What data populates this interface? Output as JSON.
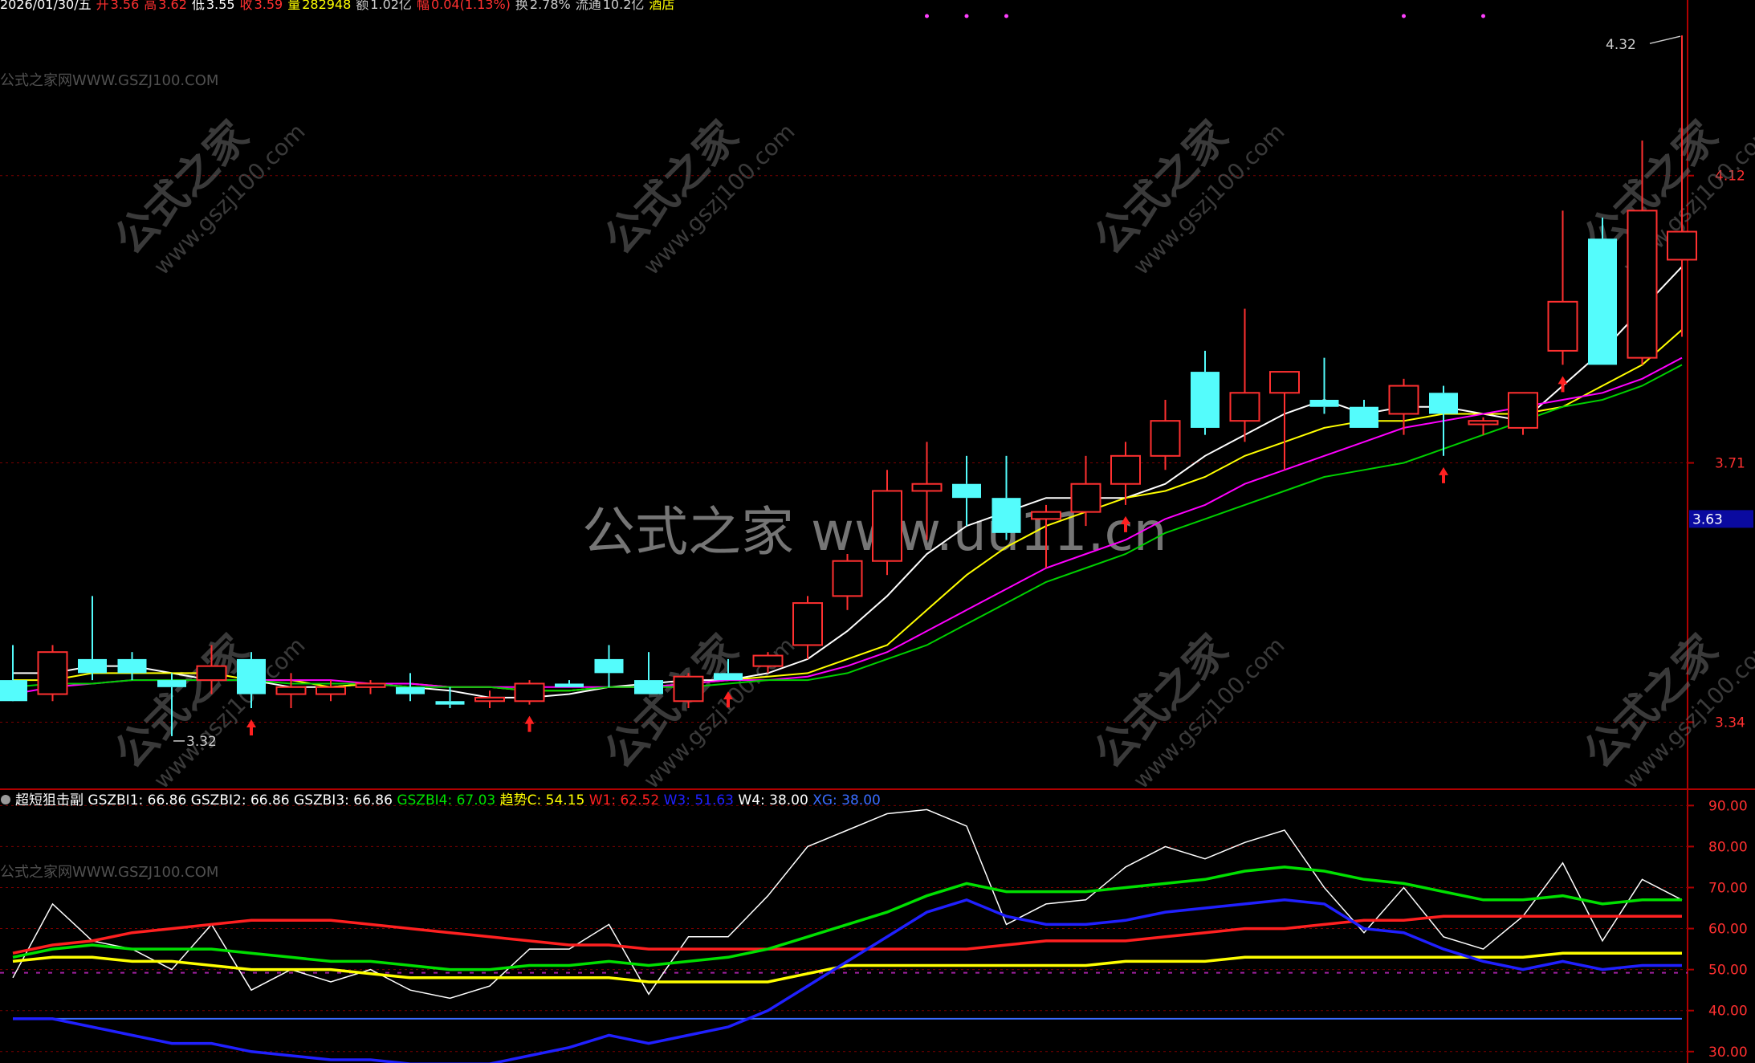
{
  "quote_bar": {
    "date": "2026/01/30/五",
    "open_label": "开",
    "open": "3.56",
    "high_label": "高",
    "high": "3.62",
    "low_label": "低",
    "low": "3.55",
    "close_label": "收",
    "close": "3.59",
    "vol_label": "量",
    "vol": "282948",
    "amt_label": "额",
    "amt": "1.02亿",
    "chg_label": "幅",
    "chg": "0.04(1.13%)",
    "turnover_label": "换",
    "turnover": "2.78%",
    "float_label": "流通",
    "float": "10.2亿",
    "sector": "酒店"
  },
  "watermark": {
    "site": "公式之家网WWW.GSZJ100.COM",
    "diag_cn": "公式之家",
    "diag_url": "www.gszj100.com",
    "center": "公式之家 www.uu11.cn"
  },
  "indicator_legend": {
    "name": "超短狙击副",
    "items": [
      {
        "label": "GSZBI1: 66.86",
        "color": "#ffffff"
      },
      {
        "label": "GSZBI2: 66.86",
        "color": "#ffffff"
      },
      {
        "label": "GSZBI3: 66.86",
        "color": "#ffffff"
      },
      {
        "label": "GSZBI4: 67.03",
        "color": "#00e000"
      },
      {
        "label": "趋势C: 54.15",
        "color": "#ffff00"
      },
      {
        "label": "W1: 62.52",
        "color": "#ff2020"
      },
      {
        "label": "W3: 51.63",
        "color": "#2020ff"
      },
      {
        "label": "W4: 38.00",
        "color": "#ffffff"
      },
      {
        "label": "XG: 38.00",
        "color": "#3a6cff"
      }
    ]
  },
  "colors": {
    "up": "#ff3030",
    "down": "#54fcfc",
    "ma5": "#ffffff",
    "ma10": "#ffff00",
    "ma20": "#ff00ff",
    "ma30": "#00d000",
    "axis": "#b00000",
    "signal": "#ff2020"
  },
  "chart_data": [
    {
      "type": "candlestick",
      "title": "",
      "price_axis_ticks": [
        "4.12",
        "3.71",
        "3.34"
      ],
      "current_price_tag": "3.63",
      "ylim": [
        3.25,
        4.35
      ],
      "annotations": [
        {
          "text": "4.32",
          "label": "high_marker"
        },
        {
          "text": "3.32",
          "label": "low_marker"
        }
      ],
      "signal_up_arrow_indices": [
        6,
        13,
        18,
        28,
        36,
        39
      ],
      "top_dot_indices": [
        23,
        24,
        25,
        35,
        37
      ],
      "candles": [
        {
          "o": 3.4,
          "h": 3.45,
          "l": 3.38,
          "c": 3.37
        },
        {
          "o": 3.38,
          "h": 3.45,
          "l": 3.37,
          "c": 3.44
        },
        {
          "o": 3.43,
          "h": 3.52,
          "l": 3.4,
          "c": 3.41
        },
        {
          "o": 3.43,
          "h": 3.44,
          "l": 3.4,
          "c": 3.41
        },
        {
          "o": 3.4,
          "h": 3.41,
          "l": 3.32,
          "c": 3.39
        },
        {
          "o": 3.4,
          "h": 3.45,
          "l": 3.38,
          "c": 3.42
        },
        {
          "o": 3.43,
          "h": 3.44,
          "l": 3.36,
          "c": 3.38
        },
        {
          "o": 3.38,
          "h": 3.41,
          "l": 3.36,
          "c": 3.39
        },
        {
          "o": 3.38,
          "h": 3.4,
          "l": 3.37,
          "c": 3.39
        },
        {
          "o": 3.39,
          "h": 3.4,
          "l": 3.38,
          "c": 3.395
        },
        {
          "o": 3.39,
          "h": 3.41,
          "l": 3.37,
          "c": 3.38
        },
        {
          "o": 3.37,
          "h": 3.39,
          "l": 3.36,
          "c": 3.365
        },
        {
          "o": 3.37,
          "h": 3.385,
          "l": 3.36,
          "c": 3.375
        },
        {
          "o": 3.37,
          "h": 3.4,
          "l": 3.365,
          "c": 3.395
        },
        {
          "o": 3.395,
          "h": 3.4,
          "l": 3.39,
          "c": 3.39
        },
        {
          "o": 3.43,
          "h": 3.45,
          "l": 3.39,
          "c": 3.41
        },
        {
          "o": 3.4,
          "h": 3.44,
          "l": 3.38,
          "c": 3.38
        },
        {
          "o": 3.37,
          "h": 3.41,
          "l": 3.36,
          "c": 3.405
        },
        {
          "o": 3.41,
          "h": 3.43,
          "l": 3.4,
          "c": 3.4
        },
        {
          "o": 3.42,
          "h": 3.44,
          "l": 3.41,
          "c": 3.435
        },
        {
          "o": 3.45,
          "h": 3.52,
          "l": 3.43,
          "c": 3.51
        },
        {
          "o": 3.52,
          "h": 3.58,
          "l": 3.5,
          "c": 3.57
        },
        {
          "o": 3.57,
          "h": 3.7,
          "l": 3.55,
          "c": 3.67
        },
        {
          "o": 3.67,
          "h": 3.74,
          "l": 3.6,
          "c": 3.68
        },
        {
          "o": 3.68,
          "h": 3.72,
          "l": 3.62,
          "c": 3.66
        },
        {
          "o": 3.66,
          "h": 3.72,
          "l": 3.6,
          "c": 3.61
        },
        {
          "o": 3.63,
          "h": 3.65,
          "l": 3.56,
          "c": 3.64
        },
        {
          "o": 3.64,
          "h": 3.72,
          "l": 3.62,
          "c": 3.68
        },
        {
          "o": 3.68,
          "h": 3.74,
          "l": 3.65,
          "c": 3.72
        },
        {
          "o": 3.72,
          "h": 3.8,
          "l": 3.7,
          "c": 3.77
        },
        {
          "o": 3.84,
          "h": 3.87,
          "l": 3.75,
          "c": 3.76
        },
        {
          "o": 3.77,
          "h": 3.93,
          "l": 3.74,
          "c": 3.81
        },
        {
          "o": 3.81,
          "h": 3.84,
          "l": 3.7,
          "c": 3.84
        },
        {
          "o": 3.8,
          "h": 3.86,
          "l": 3.78,
          "c": 3.79
        },
        {
          "o": 3.79,
          "h": 3.8,
          "l": 3.76,
          "c": 3.76
        },
        {
          "o": 3.78,
          "h": 3.83,
          "l": 3.75,
          "c": 3.82
        },
        {
          "o": 3.81,
          "h": 3.82,
          "l": 3.72,
          "c": 3.78
        },
        {
          "o": 3.765,
          "h": 3.775,
          "l": 3.75,
          "c": 3.77
        },
        {
          "o": 3.76,
          "h": 3.81,
          "l": 3.75,
          "c": 3.81
        },
        {
          "o": 3.87,
          "h": 4.07,
          "l": 3.85,
          "c": 3.94
        },
        {
          "o": 4.03,
          "h": 4.06,
          "l": 3.85,
          "c": 3.85
        },
        {
          "o": 3.86,
          "h": 4.17,
          "l": 3.85,
          "c": 4.07
        },
        {
          "o": 4.0,
          "h": 4.32,
          "l": 3.89,
          "c": 4.04
        }
      ],
      "ma_lines": {
        "MA5": [
          3.41,
          3.41,
          3.42,
          3.42,
          3.41,
          3.4,
          3.4,
          3.39,
          3.39,
          3.395,
          3.39,
          3.385,
          3.375,
          3.375,
          3.38,
          3.39,
          3.395,
          3.4,
          3.4,
          3.41,
          3.43,
          3.47,
          3.52,
          3.58,
          3.62,
          3.64,
          3.66,
          3.66,
          3.66,
          3.68,
          3.72,
          3.75,
          3.78,
          3.8,
          3.78,
          3.79,
          3.79,
          3.78,
          3.77,
          3.82,
          3.87,
          3.93,
          3.99
        ],
        "MA10": [
          3.4,
          3.4,
          3.41,
          3.41,
          3.41,
          3.41,
          3.4,
          3.4,
          3.39,
          3.395,
          3.395,
          3.39,
          3.39,
          3.385,
          3.385,
          3.39,
          3.39,
          3.395,
          3.4,
          3.405,
          3.41,
          3.43,
          3.45,
          3.5,
          3.55,
          3.59,
          3.62,
          3.64,
          3.66,
          3.67,
          3.69,
          3.72,
          3.74,
          3.76,
          3.77,
          3.77,
          3.78,
          3.78,
          3.78,
          3.79,
          3.82,
          3.85,
          3.9
        ],
        "MA20": [
          3.38,
          3.39,
          3.395,
          3.4,
          3.4,
          3.4,
          3.4,
          3.4,
          3.4,
          3.395,
          3.395,
          3.39,
          3.39,
          3.39,
          3.39,
          3.39,
          3.39,
          3.395,
          3.4,
          3.4,
          3.405,
          3.42,
          3.44,
          3.47,
          3.5,
          3.53,
          3.56,
          3.58,
          3.6,
          3.63,
          3.65,
          3.68,
          3.7,
          3.72,
          3.74,
          3.76,
          3.77,
          3.78,
          3.79,
          3.8,
          3.81,
          3.83,
          3.86
        ],
        "MA30": [
          3.39,
          3.395,
          3.395,
          3.4,
          3.4,
          3.4,
          3.4,
          3.395,
          3.395,
          3.395,
          3.39,
          3.39,
          3.39,
          3.385,
          3.385,
          3.39,
          3.39,
          3.39,
          3.395,
          3.4,
          3.4,
          3.41,
          3.43,
          3.45,
          3.48,
          3.51,
          3.54,
          3.56,
          3.58,
          3.61,
          3.63,
          3.65,
          3.67,
          3.69,
          3.7,
          3.71,
          3.73,
          3.75,
          3.77,
          3.79,
          3.8,
          3.82,
          3.85
        ]
      }
    },
    {
      "type": "line",
      "title": "超短狙击副",
      "ylim": [
        28,
        93
      ],
      "y_ticks": [
        "90.00",
        "80.00",
        "70.00",
        "60.00",
        "50.00",
        "40.00",
        "30.00"
      ],
      "x": [
        0,
        1,
        2,
        3,
        4,
        5,
        6,
        7,
        8,
        9,
        10,
        11,
        12,
        13,
        14,
        15,
        16,
        17,
        18,
        19,
        20,
        21,
        22,
        23,
        24,
        25,
        26,
        27,
        28,
        29,
        30,
        31,
        32,
        33,
        34,
        35,
        36,
        37,
        38,
        39,
        40,
        41,
        42
      ],
      "series": [
        {
          "name": "GSZBI1",
          "color": "#ffffff",
          "values": [
            48,
            66,
            57,
            55,
            50,
            61,
            45,
            50,
            47,
            50,
            45,
            43,
            46,
            55,
            55,
            61,
            44,
            58,
            58,
            68,
            80,
            84,
            88,
            89,
            85,
            61,
            66,
            67,
            75,
            80,
            77,
            81,
            84,
            70,
            59,
            70,
            58,
            55,
            63,
            76,
            57,
            72,
            67
          ]
        },
        {
          "name": "GSZBI4",
          "color": "#00e000",
          "values": [
            53,
            55,
            56,
            55,
            55,
            55,
            54,
            53,
            52,
            52,
            51,
            50,
            50,
            51,
            51,
            52,
            51,
            52,
            53,
            55,
            58,
            61,
            64,
            68,
            71,
            69,
            69,
            69,
            70,
            71,
            72,
            74,
            75,
            74,
            72,
            71,
            69,
            67,
            67,
            68,
            66,
            67,
            67
          ]
        },
        {
          "name": "趋势C",
          "color": "#ffff00",
          "values": [
            52,
            53,
            53,
            52,
            52,
            51,
            50,
            50,
            50,
            49,
            48,
            48,
            48,
            48,
            48,
            48,
            47,
            47,
            47,
            47,
            49,
            51,
            51,
            51,
            51,
            51,
            51,
            51,
            52,
            52,
            52,
            53,
            53,
            53,
            53,
            53,
            53,
            53,
            53,
            54,
            54,
            54,
            54
          ]
        },
        {
          "name": "W1",
          "color": "#ff2020",
          "values": [
            54,
            56,
            57,
            59,
            60,
            61,
            62,
            62,
            62,
            61,
            60,
            59,
            58,
            57,
            56,
            56,
            55,
            55,
            55,
            55,
            55,
            55,
            55,
            55,
            55,
            56,
            57,
            57,
            57,
            58,
            59,
            60,
            60,
            61,
            62,
            62,
            63,
            63,
            63,
            63,
            63,
            63,
            63
          ]
        },
        {
          "name": "W3",
          "color": "#2020ff",
          "values": [
            38,
            38,
            36,
            34,
            32,
            32,
            30,
            29,
            28,
            28,
            27,
            27,
            27,
            29,
            31,
            34,
            32,
            34,
            36,
            40,
            46,
            52,
            58,
            64,
            67,
            63,
            61,
            61,
            62,
            64,
            65,
            66,
            67,
            66,
            60,
            59,
            55,
            52,
            50,
            52,
            50,
            51,
            51
          ]
        },
        {
          "name": "XG",
          "color": "#3a6cff",
          "values": [
            38,
            38,
            38,
            38,
            38,
            38,
            38,
            38,
            38,
            38,
            38,
            38,
            38,
            38,
            38,
            38,
            38,
            38,
            38,
            38,
            38,
            38,
            38,
            38,
            38,
            38,
            38,
            38,
            38,
            38,
            38,
            38,
            38,
            38,
            38,
            38,
            38,
            38,
            38,
            38,
            38,
            38,
            38
          ]
        }
      ]
    }
  ]
}
